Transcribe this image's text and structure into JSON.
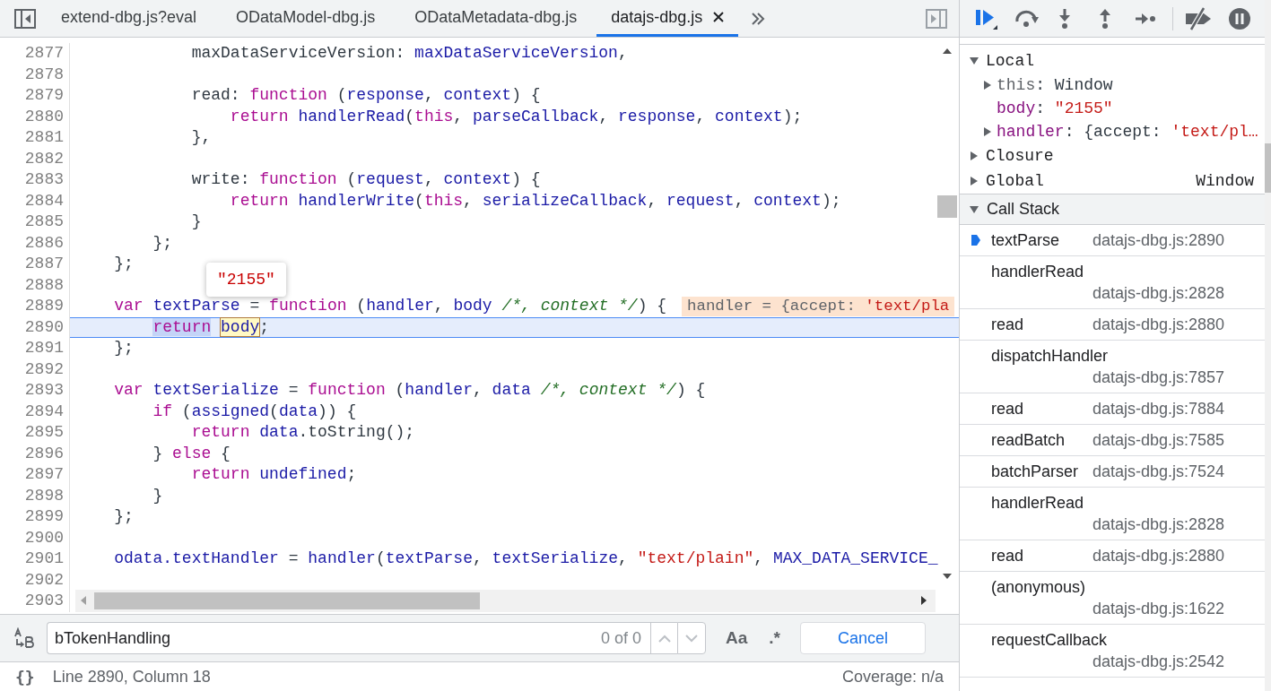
{
  "tabs": [
    {
      "label": "extend-dbg.js?eval",
      "selected": false
    },
    {
      "label": "ODataModel-dbg.js",
      "selected": false
    },
    {
      "label": "ODataMetadata-dbg.js",
      "selected": false
    },
    {
      "label": "datajs-dbg.js",
      "selected": true
    }
  ],
  "editor": {
    "lines": [
      {
        "number": "2877",
        "current": false,
        "tokens": [
          {
            "kind": "plain",
            "text": "            maxDataServiceVersion: "
          },
          {
            "kind": "variable",
            "text": "maxDataServiceVersion"
          },
          {
            "kind": "plain",
            "text": ","
          }
        ]
      },
      {
        "number": "2878",
        "current": false
      },
      {
        "number": "2879",
        "current": false,
        "tokens": [
          {
            "kind": "plain",
            "text": "            read: "
          },
          {
            "kind": "keyword",
            "text": "function"
          },
          {
            "kind": "plain",
            "text": " ("
          },
          {
            "kind": "variable",
            "text": "response"
          },
          {
            "kind": "plain",
            "text": ", "
          },
          {
            "kind": "variable",
            "text": "context"
          },
          {
            "kind": "plain",
            "text": ") {"
          }
        ]
      },
      {
        "number": "2880",
        "current": false,
        "tokens": [
          {
            "kind": "keyword",
            "text": "                return "
          },
          {
            "kind": "variable",
            "text": "handlerRead"
          },
          {
            "kind": "plain",
            "text": "("
          },
          {
            "kind": "keyword",
            "text": "this"
          },
          {
            "kind": "plain",
            "text": ", "
          },
          {
            "kind": "variable",
            "text": "parseCallback"
          },
          {
            "kind": "plain",
            "text": ", "
          },
          {
            "kind": "variable",
            "text": "response"
          },
          {
            "kind": "plain",
            "text": ", "
          },
          {
            "kind": "variable",
            "text": "context"
          },
          {
            "kind": "plain",
            "text": ");"
          }
        ]
      },
      {
        "number": "2881",
        "current": false,
        "tokens": [
          {
            "kind": "plain",
            "text": "            },"
          }
        ]
      },
      {
        "number": "2882",
        "current": false
      },
      {
        "number": "2883",
        "current": false,
        "tokens": [
          {
            "kind": "plain",
            "text": "            write: "
          },
          {
            "kind": "keyword",
            "text": "function"
          },
          {
            "kind": "plain",
            "text": " ("
          },
          {
            "kind": "variable",
            "text": "request"
          },
          {
            "kind": "plain",
            "text": ", "
          },
          {
            "kind": "variable",
            "text": "context"
          },
          {
            "kind": "plain",
            "text": ") {"
          }
        ]
      },
      {
        "number": "2884",
        "current": false,
        "tokens": [
          {
            "kind": "keyword",
            "text": "                return "
          },
          {
            "kind": "variable",
            "text": "handlerWrite"
          },
          {
            "kind": "plain",
            "text": "("
          },
          {
            "kind": "keyword",
            "text": "this"
          },
          {
            "kind": "plain",
            "text": ", "
          },
          {
            "kind": "variable",
            "text": "serializeCallback"
          },
          {
            "kind": "plain",
            "text": ", "
          },
          {
            "kind": "variable",
            "text": "request"
          },
          {
            "kind": "plain",
            "text": ", "
          },
          {
            "kind": "variable",
            "text": "context"
          },
          {
            "kind": "plain",
            "text": ");"
          }
        ]
      },
      {
        "number": "2885",
        "current": false,
        "tokens": [
          {
            "kind": "plain",
            "text": "            }"
          }
        ]
      },
      {
        "number": "2886",
        "current": false,
        "tokens": [
          {
            "kind": "plain",
            "text": "        };"
          }
        ]
      },
      {
        "number": "2887",
        "current": false,
        "tokens": [
          {
            "kind": "plain",
            "text": "    };"
          }
        ]
      },
      {
        "number": "2888",
        "current": false
      },
      {
        "number": "2889",
        "current": false,
        "tokens": [
          {
            "kind": "keyword",
            "text": "    var "
          },
          {
            "kind": "variable",
            "text": "textParse"
          },
          {
            "kind": "plain",
            "text": " = "
          },
          {
            "kind": "keyword",
            "text": "function"
          },
          {
            "kind": "plain",
            "text": " ("
          },
          {
            "kind": "variable",
            "text": "handler"
          },
          {
            "kind": "plain",
            "text": ", "
          },
          {
            "kind": "variable",
            "text": "body "
          },
          {
            "kind": "comment",
            "text": "/*, context */"
          },
          {
            "kind": "plain",
            "text": ") {"
          }
        ],
        "inline_value": {
          "text": "handler = {accept: ",
          "string": "'text/pla"
        }
      },
      {
        "number": "2890",
        "current": true,
        "tokens": [
          {
            "kind": "keyword",
            "text": "        return ",
            "selected": true
          },
          {
            "kind": "variable",
            "text": "body",
            "hovered": true
          },
          {
            "kind": "plain",
            "text": ";"
          }
        ]
      },
      {
        "number": "2891",
        "current": false,
        "tokens": [
          {
            "kind": "plain",
            "text": "    };"
          }
        ]
      },
      {
        "number": "2892",
        "current": false
      },
      {
        "number": "2893",
        "current": false,
        "tokens": [
          {
            "kind": "keyword",
            "text": "    var "
          },
          {
            "kind": "variable",
            "text": "textSerialize"
          },
          {
            "kind": "plain",
            "text": " = "
          },
          {
            "kind": "keyword",
            "text": "function"
          },
          {
            "kind": "plain",
            "text": " ("
          },
          {
            "kind": "variable",
            "text": "handler"
          },
          {
            "kind": "plain",
            "text": ", "
          },
          {
            "kind": "variable",
            "text": "data "
          },
          {
            "kind": "comment",
            "text": "/*, context */"
          },
          {
            "kind": "plain",
            "text": ") {"
          }
        ]
      },
      {
        "number": "2894",
        "current": false,
        "tokens": [
          {
            "kind": "keyword",
            "text": "        if"
          },
          {
            "kind": "plain",
            "text": " ("
          },
          {
            "kind": "variable",
            "text": "assigned"
          },
          {
            "kind": "plain",
            "text": "("
          },
          {
            "kind": "variable",
            "text": "data"
          },
          {
            "kind": "plain",
            "text": ")) {"
          }
        ]
      },
      {
        "number": "2895",
        "current": false,
        "tokens": [
          {
            "kind": "keyword",
            "text": "            return "
          },
          {
            "kind": "variable",
            "text": "data"
          },
          {
            "kind": "plain",
            "text": ".toString();"
          }
        ]
      },
      {
        "number": "2896",
        "current": false,
        "tokens": [
          {
            "kind": "plain",
            "text": "        } "
          },
          {
            "kind": "keyword",
            "text": "else"
          },
          {
            "kind": "plain",
            "text": " {"
          }
        ]
      },
      {
        "number": "2897",
        "current": false,
        "tokens": [
          {
            "kind": "keyword",
            "text": "            return "
          },
          {
            "kind": "variable",
            "text": "undefined"
          },
          {
            "kind": "plain",
            "text": ";"
          }
        ]
      },
      {
        "number": "2898",
        "current": false,
        "tokens": [
          {
            "kind": "plain",
            "text": "        }"
          }
        ]
      },
      {
        "number": "2899",
        "current": false,
        "tokens": [
          {
            "kind": "plain",
            "text": "    };"
          }
        ]
      },
      {
        "number": "2900",
        "current": false
      },
      {
        "number": "2901",
        "current": false,
        "tokens": [
          {
            "kind": "variable",
            "text": "    odata.textHandler"
          },
          {
            "kind": "plain",
            "text": " = "
          },
          {
            "kind": "variable",
            "text": "handler"
          },
          {
            "kind": "plain",
            "text": "("
          },
          {
            "kind": "variable",
            "text": "textParse"
          },
          {
            "kind": "plain",
            "text": ", "
          },
          {
            "kind": "variable",
            "text": "textSerialize"
          },
          {
            "kind": "plain",
            "text": ", "
          },
          {
            "kind": "string",
            "text": "\"text/plain\""
          },
          {
            "kind": "plain",
            "text": ", "
          },
          {
            "kind": "variable",
            "text": "MAX_DATA_SERVICE_"
          }
        ]
      },
      {
        "number": "2902",
        "current": false
      },
      {
        "number": "2903",
        "current": false
      }
    ],
    "tooltip": {
      "value": "\"2155\""
    }
  },
  "search": {
    "query": "bTokenHandling",
    "count": "0 of 0",
    "match_case": "Aa",
    "regex": ".*",
    "cancel": "Cancel"
  },
  "status_bar": {
    "pretty_print": "{}",
    "position": "Line 2890, Column 18",
    "coverage": "Coverage: n/a"
  },
  "scope": {
    "sections": [
      {
        "name": "Local",
        "expanded": true,
        "variables": [
          {
            "name": "this",
            "kind": "object",
            "dimmed": true,
            "value": [
              {
                "kind": "plain",
                "text": ": Window"
              }
            ]
          },
          {
            "name": "body",
            "kind": "primitive",
            "dimmed": false,
            "value": [
              {
                "kind": "plain",
                "text": ": "
              },
              {
                "kind": "string",
                "text": "\"2155\""
              }
            ]
          },
          {
            "name": "handler",
            "kind": "object",
            "dimmed": false,
            "value": [
              {
                "kind": "plain",
                "text": ": {accept: "
              },
              {
                "kind": "string",
                "text": "'text/pl…"
              }
            ]
          }
        ]
      },
      {
        "name": "Closure",
        "expanded": false
      },
      {
        "name": "Global",
        "expanded": false,
        "value": "Window"
      }
    ]
  },
  "call_stack": {
    "title": "Call Stack",
    "expanded": true,
    "frames": [
      {
        "function": "textParse",
        "location": "datajs-dbg.js:2890",
        "selected": true
      },
      {
        "function": "handlerRead",
        "location": "datajs-dbg.js:2828",
        "selected": false
      },
      {
        "function": "read",
        "location": "datajs-dbg.js:2880",
        "selected": false
      },
      {
        "function": "dispatchHandler",
        "location": "datajs-dbg.js:7857",
        "selected": false
      },
      {
        "function": "read",
        "location": "datajs-dbg.js:7884",
        "selected": false
      },
      {
        "function": "readBatch",
        "location": "datajs-dbg.js:7585",
        "selected": false
      },
      {
        "function": "batchParser",
        "location": "datajs-dbg.js:7524",
        "selected": false
      },
      {
        "function": "handlerRead",
        "location": "datajs-dbg.js:2828",
        "selected": false
      },
      {
        "function": "read",
        "location": "datajs-dbg.js:2880",
        "selected": false
      },
      {
        "function": "(anonymous)",
        "location": "datajs-dbg.js:1622",
        "selected": false
      },
      {
        "function": "requestCallback",
        "location": "datajs-dbg.js:2542",
        "selected": false
      }
    ]
  }
}
